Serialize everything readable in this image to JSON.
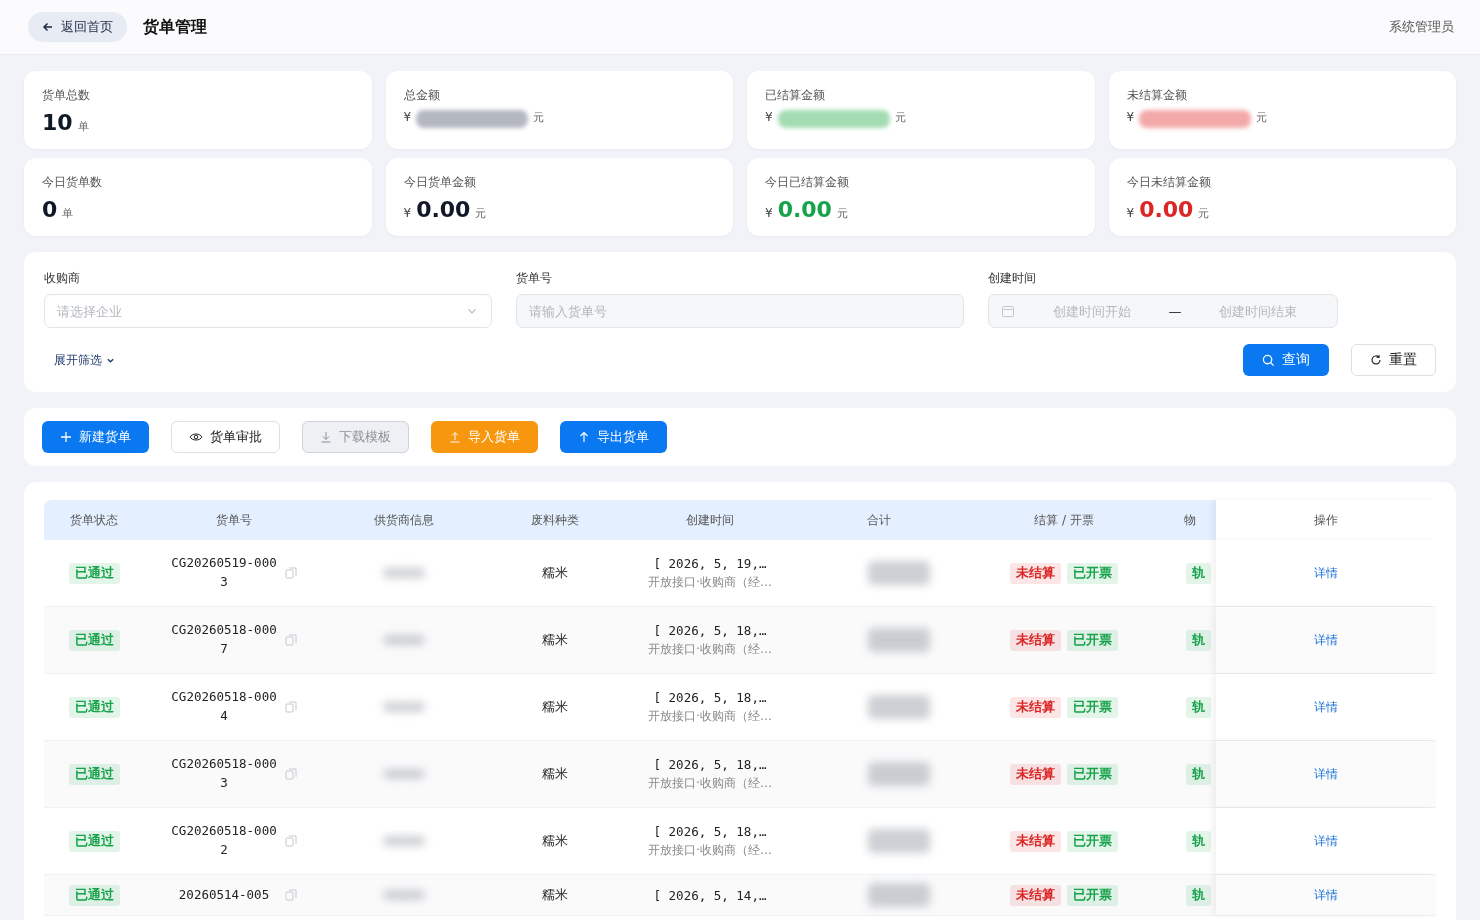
{
  "header": {
    "back": "返回首页",
    "title": "货单管理",
    "user": "系统管理员"
  },
  "cards": [
    {
      "label": "货单总数",
      "value": "10",
      "unit": "单",
      "blurred": false,
      "color": "#111827"
    },
    {
      "label": "总金额",
      "currency": "¥",
      "unit": "元",
      "blurred": true,
      "color": "#b4b8c0"
    },
    {
      "label": "已结算金额",
      "currency": "¥",
      "unit": "元",
      "blurred": true,
      "color": "#a3dcb2"
    },
    {
      "label": "未结算金额",
      "currency": "¥",
      "unit": "元",
      "blurred": true,
      "color": "#f4a9a9"
    },
    {
      "label": "今日货单数",
      "value": "0",
      "unit": "单",
      "blurred": false,
      "color": "#111827"
    },
    {
      "label": "今日货单金额",
      "currency": "¥",
      "value": "0.00",
      "unit": "元",
      "blurred": false,
      "color": "#111827"
    },
    {
      "label": "今日已结算金额",
      "currency": "¥",
      "value": "0.00",
      "unit": "元",
      "blurred": false,
      "color": "#16a34a"
    },
    {
      "label": "今日未结算金额",
      "currency": "¥",
      "value": "0.00",
      "unit": "元",
      "blurred": false,
      "color": "#dc2626"
    }
  ],
  "filters": {
    "buyer": {
      "label": "收购商",
      "placeholder": "请选择企业"
    },
    "order_no": {
      "label": "货单号",
      "placeholder": "请输入货单号"
    },
    "created": {
      "label": "创建时间",
      "start_placeholder": "创建时间开始",
      "separator": "—",
      "end_placeholder": "创建时间结束"
    },
    "expand": "展开筛选",
    "query": "查询",
    "reset": "重置"
  },
  "toolbar": [
    {
      "label": "新建货单",
      "kind": "primary",
      "disabled": false
    },
    {
      "label": "货单审批",
      "kind": "outline",
      "disabled": false
    },
    {
      "label": "下载模板",
      "kind": "outline",
      "disabled": true
    },
    {
      "label": "导入货单",
      "kind": "warning",
      "disabled": false
    },
    {
      "label": "导出货单",
      "kind": "primary",
      "disabled": false
    }
  ],
  "table": {
    "columns": [
      "货单状态",
      "货单号",
      "供货商信息",
      "废料种类",
      "创建时间",
      "合计",
      "结算 / 开票",
      "物",
      "操作"
    ],
    "rows": [
      {
        "status": {
          "text": "已通过",
          "color": "#16a34a"
        },
        "order_no": "CG20260519-0003",
        "type": "糯米",
        "time": "[ 2026, 5, 19,…",
        "time_sub": "开放接口·收购商（经…",
        "tags": [
          {
            "text": "未结算",
            "color": "#dc2626"
          },
          {
            "text": "已开票",
            "color": "#16a34a"
          }
        ],
        "logistics": "轨",
        "action": "详情"
      },
      {
        "status": {
          "text": "已通过",
          "color": "#16a34a"
        },
        "order_no": "CG20260518-0007",
        "type": "糯米",
        "time": "[ 2026, 5, 18,…",
        "time_sub": "开放接口·收购商（经…",
        "tags": [
          {
            "text": "未结算",
            "color": "#dc2626"
          },
          {
            "text": "已开票",
            "color": "#16a34a"
          }
        ],
        "logistics": "轨",
        "action": "详情"
      },
      {
        "status": {
          "text": "已通过",
          "color": "#16a34a"
        },
        "order_no": "CG20260518-0004",
        "type": "糯米",
        "time": "[ 2026, 5, 18,…",
        "time_sub": "开放接口·收购商（经…",
        "tags": [
          {
            "text": "未结算",
            "color": "#dc2626"
          },
          {
            "text": "已开票",
            "color": "#16a34a"
          }
        ],
        "logistics": "轨",
        "action": "详情"
      },
      {
        "status": {
          "text": "已通过",
          "color": "#16a34a"
        },
        "order_no": "CG20260518-0003",
        "type": "糯米",
        "time": "[ 2026, 5, 18,…",
        "time_sub": "开放接口·收购商（经…",
        "tags": [
          {
            "text": "未结算",
            "color": "#dc2626"
          },
          {
            "text": "已开票",
            "color": "#16a34a"
          }
        ],
        "logistics": "轨",
        "action": "详情"
      },
      {
        "status": {
          "text": "已通过",
          "color": "#16a34a"
        },
        "order_no": "CG20260518-0002",
        "type": "糯米",
        "time": "[ 2026, 5, 18,…",
        "time_sub": "开放接口·收购商（经…",
        "tags": [
          {
            "text": "未结算",
            "color": "#dc2626"
          },
          {
            "text": "已开票",
            "color": "#16a34a"
          }
        ],
        "logistics": "轨",
        "action": "详情"
      },
      {
        "status": {
          "text": "已通过",
          "color": "#16a34a"
        },
        "order_no": "20260514-005",
        "type": "糯米",
        "time": "[ 2026, 5, 14,…",
        "tags": [
          {
            "text": "未结算",
            "color": "#dc2626"
          },
          {
            "text": "已开票",
            "color": "#16a34a"
          }
        ],
        "logistics": "轨",
        "action": "详情"
      }
    ]
  }
}
